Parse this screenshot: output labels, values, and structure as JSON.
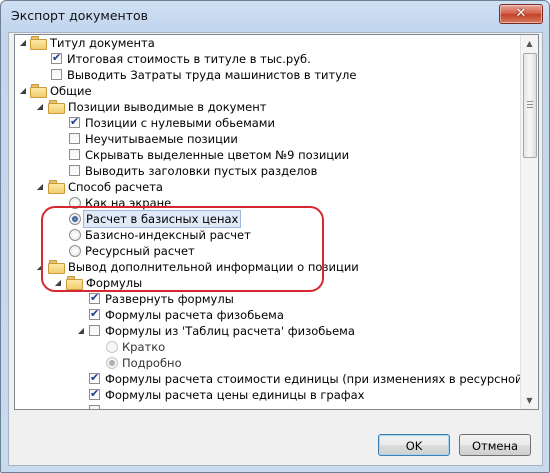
{
  "window": {
    "title": "Экспорт документов",
    "close_icon": "close-icon"
  },
  "tree": {
    "nodes": [
      {
        "id": "titul",
        "label": "Титул документа"
      },
      {
        "id": "titul_cost",
        "label": "Итоговая стоимость в титуле в тыс.руб.",
        "checked": true
      },
      {
        "id": "titul_labor",
        "label": "Выводить Затраты труда машинистов в титуле",
        "checked": false
      },
      {
        "id": "common",
        "label": "Общие"
      },
      {
        "id": "positions",
        "label": "Позиции выводимые в документ"
      },
      {
        "id": "zero",
        "label": "Позиции с нулевыми обьемами",
        "checked": true
      },
      {
        "id": "uncounted",
        "label": "Неучитываемые позиции",
        "checked": false
      },
      {
        "id": "hide9",
        "label": "Скрывать выделенные цветом №9 позиции",
        "checked": false
      },
      {
        "id": "emptysec",
        "label": "Выводить заголовки пустых разделов",
        "checked": false
      },
      {
        "id": "method",
        "label": "Способ расчета"
      },
      {
        "id": "m_screen",
        "label": "Как на экране",
        "selected": false
      },
      {
        "id": "m_base",
        "label": "Расчет в базисных ценах",
        "selected": true
      },
      {
        "id": "m_index",
        "label": "Базисно-индексный расчет",
        "selected": false
      },
      {
        "id": "m_resource",
        "label": "Ресурсный расчет",
        "selected": false
      },
      {
        "id": "extra",
        "label": "Вывод дополнительной информации о позиции"
      },
      {
        "id": "formulas",
        "label": "Формулы"
      },
      {
        "id": "f_expand",
        "label": "Развернуть формулы",
        "checked": true
      },
      {
        "id": "f_fizob",
        "label": "Формулы расчета физобьема",
        "checked": true
      },
      {
        "id": "f_tables",
        "label": "Формулы из 'Таблиц расчета' физобьема",
        "checked": false
      },
      {
        "id": "f_brief",
        "label": "Кратко",
        "selected": false,
        "disabled": true
      },
      {
        "id": "f_detail",
        "label": "Подробно",
        "selected": true,
        "disabled": true
      },
      {
        "id": "f_unitcost",
        "label": "Формулы расчета стоимости единицы (при изменениях в ресурсной части)",
        "checked": true
      },
      {
        "id": "f_unitgraph",
        "label": "Формулы расчета цены единицы в графах",
        "checked": true
      }
    ]
  },
  "buttons": {
    "ok": "OK",
    "cancel": "Отмена"
  },
  "colors": {
    "highlight": "#d6282e",
    "selection_bg": "#dfe9f7"
  }
}
